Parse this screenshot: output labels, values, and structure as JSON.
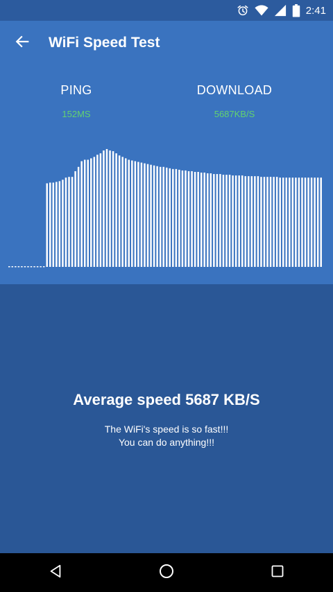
{
  "status_bar": {
    "time": "2:41",
    "icons": [
      "alarm-icon",
      "wifi-icon",
      "signal-icon",
      "battery-icon"
    ]
  },
  "app_bar": {
    "title": "WiFi Speed Test",
    "back_icon": "arrow-back-icon"
  },
  "metrics": {
    "ping": {
      "label": "PING",
      "value": "152MS"
    },
    "download": {
      "label": "DOWNLOAD",
      "value": "5687KB/S"
    }
  },
  "chart_data": {
    "type": "bar",
    "title": "",
    "values": [
      0,
      0,
      0,
      0,
      0,
      0,
      0,
      0,
      0,
      0,
      0,
      0,
      117,
      118,
      118,
      119,
      120,
      122,
      125,
      126,
      126,
      134,
      140,
      148,
      150,
      150,
      152,
      154,
      157,
      159,
      163,
      165,
      163,
      162,
      159,
      156,
      154,
      152,
      150,
      149,
      148,
      147,
      146,
      145,
      144,
      143,
      142,
      141,
      140,
      140,
      139,
      138,
      137,
      137,
      136,
      135,
      135,
      134,
      134,
      133,
      133,
      132,
      132,
      131,
      131,
      130,
      130,
      130,
      129,
      129,
      129,
      128,
      128,
      128,
      128,
      127,
      127,
      127,
      127,
      127,
      126,
      126,
      126,
      126,
      126,
      126,
      125,
      125,
      125,
      125,
      125,
      125,
      125,
      125,
      125,
      125,
      125,
      125,
      125,
      125
    ],
    "baseline_style": "dotted",
    "colors": {
      "bar": "#ffffff"
    }
  },
  "summary": {
    "average": "Average speed 5687 KB/S",
    "message_line1": "The WiFi's speed is so fast!!!",
    "message_line2": "You can do anything!!!"
  },
  "nav_bar": {
    "back": "nav-back-icon",
    "home": "nav-home-icon",
    "recents": "nav-recents-icon"
  },
  "colors": {
    "primary": "#3a73bf",
    "primary_dark": "#2a5796",
    "status_bar": "#2c5b9e",
    "accent_green": "#63d26f"
  }
}
